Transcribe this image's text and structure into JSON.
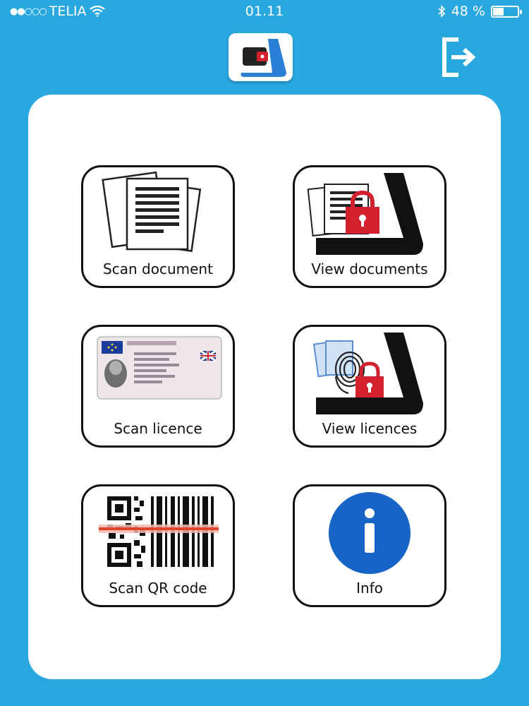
{
  "status_bar": {
    "carrier": "TELIA",
    "time": "01.11",
    "battery_percent_text": "48 %",
    "battery_level": 0.48
  },
  "colors": {
    "background": "#29a8e0",
    "lock_red": "#d2202e",
    "info_blue": "#1763c6"
  },
  "header": {
    "logo_icon": "wallet-app-icon",
    "logout_icon": "logout-icon"
  },
  "tiles": [
    {
      "label": "Scan document",
      "icon": "documents-icon"
    },
    {
      "label": "View documents",
      "icon": "locked-documents-icon"
    },
    {
      "label": "Scan licence",
      "icon": "driving-licence-icon"
    },
    {
      "label": "View licences",
      "icon": "fingerprint-lock-icon"
    },
    {
      "label": "Scan QR code",
      "icon": "qr-barcode-icon"
    },
    {
      "label": "Info",
      "icon": "info-icon"
    }
  ]
}
